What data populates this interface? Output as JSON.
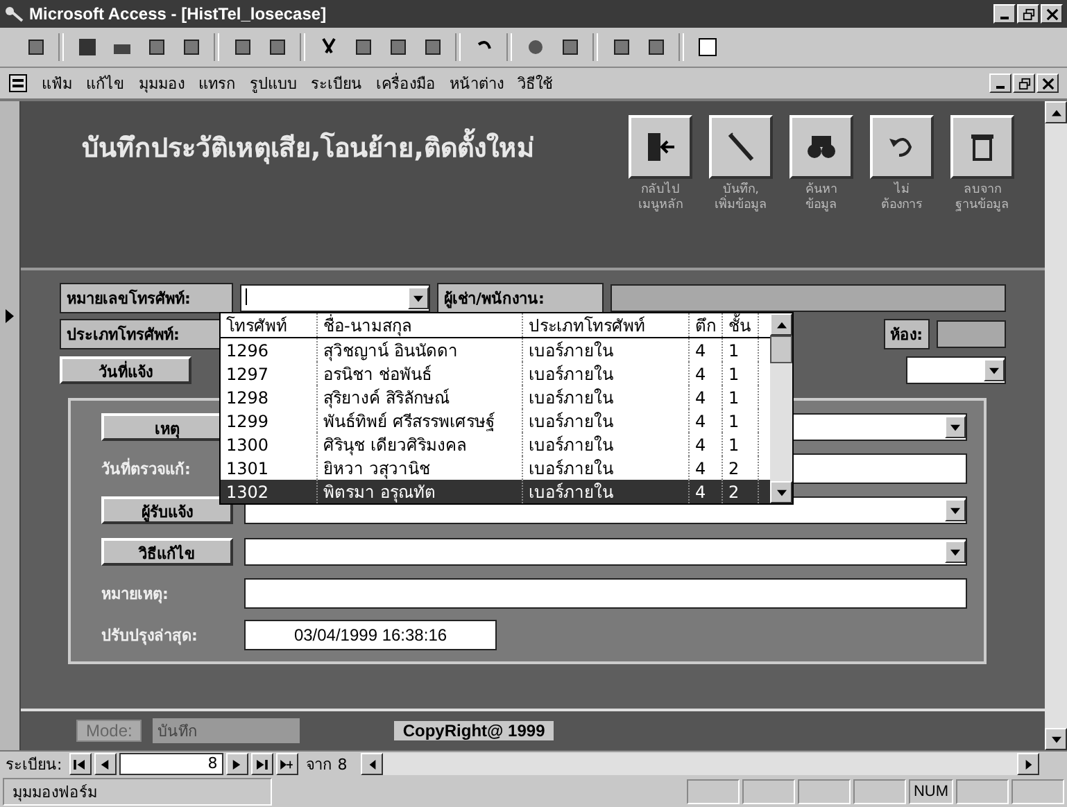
{
  "window": {
    "title": "Microsoft Access - [HistTel_losecase]"
  },
  "menu": [
    "แฟ้ม",
    "แก้ไข",
    "มุมมอง",
    "แทรก",
    "รูปแบบ",
    "ระเบียน",
    "เครื่องมือ",
    "หน้าต่าง",
    "วิธีใช้"
  ],
  "form": {
    "title": "บันทึกประวัติเหตุเสีย,โอนย้าย,ติดตั้งใหม่",
    "actions": [
      {
        "kind": "exit",
        "lines": [
          "กลับไป",
          "เมนูหลัก"
        ]
      },
      {
        "kind": "pen",
        "lines": [
          "บันทึก,",
          "เพิ่มข้อมูล"
        ]
      },
      {
        "kind": "find",
        "lines": [
          "ค้นหา",
          "ข้อมูล"
        ]
      },
      {
        "kind": "undo",
        "lines": [
          "ไม่",
          "ต้องการ"
        ]
      },
      {
        "kind": "delete",
        "lines": [
          "ลบจาก",
          "ฐานข้อมูล"
        ]
      }
    ]
  },
  "header_fields": {
    "phone_label": "หมายเลขโทรศัพท์:",
    "tenant_label": "ผู้เช่า/พนักงาน:",
    "type_label": "ประเภทโทรศัพท์:",
    "room_label": "ห้อง:",
    "date_label": "วันที่แจ้ง"
  },
  "dropdown": {
    "columns": [
      "โทรศัพท์",
      "ชื่อ-นามสกุล",
      "ประเภทโทรศัพท์",
      "ตึก",
      "ชั้น"
    ],
    "rows": [
      {
        "cells": [
          "1296",
          "สุวิชญาน์ อินนัดดา",
          "เบอร์ภายใน",
          "4",
          "1"
        ],
        "selected": false
      },
      {
        "cells": [
          "1297",
          "อรนิชา ช่อพันธ์",
          "เบอร์ภายใน",
          "4",
          "1"
        ],
        "selected": false
      },
      {
        "cells": [
          "1298",
          "สุริยางค์ สิริลักษณ์",
          "เบอร์ภายใน",
          "4",
          "1"
        ],
        "selected": false
      },
      {
        "cells": [
          "1299",
          "พันธ์ทิพย์ ศรีสรรพเศรษฐ์",
          "เบอร์ภายใน",
          "4",
          "1"
        ],
        "selected": false
      },
      {
        "cells": [
          "1300",
          "ศิรินุช เดียวศิริมงคล",
          "เบอร์ภายใน",
          "4",
          "1"
        ],
        "selected": false
      },
      {
        "cells": [
          "1301",
          "ยิหวา วสุวานิช",
          "เบอร์ภายใน",
          "4",
          "2"
        ],
        "selected": false
      },
      {
        "cells": [
          "1302",
          "พิตรมา อรุณทัต",
          "เบอร์ภายใน",
          "4",
          "2"
        ],
        "selected": true
      }
    ]
  },
  "detail": [
    {
      "kind": "picker",
      "label": "เหตุ"
    },
    {
      "kind": "entry",
      "label": "วันที่ตรวจแก้:"
    },
    {
      "kind": "picker",
      "label": "ผู้รับแจ้ง"
    },
    {
      "kind": "picker",
      "label": "วิธีแก้ไข"
    },
    {
      "kind": "entry",
      "label": "หมายเหตุ:"
    },
    {
      "kind": "stamp",
      "label": "ปรับปรุงล่าสุด:",
      "value": "03/04/1999 16:38:16"
    }
  ],
  "footer": {
    "mode_label": "Mode:",
    "mode_value": "บันทึก",
    "copyright": "CopyRight@ 1999"
  },
  "navigator": {
    "label": "ระเบียน:",
    "current": "8",
    "total": "จาก 8"
  },
  "status_bar": {
    "text": "มุมมองฟอร์ม",
    "indicators": [
      "NUM"
    ]
  }
}
